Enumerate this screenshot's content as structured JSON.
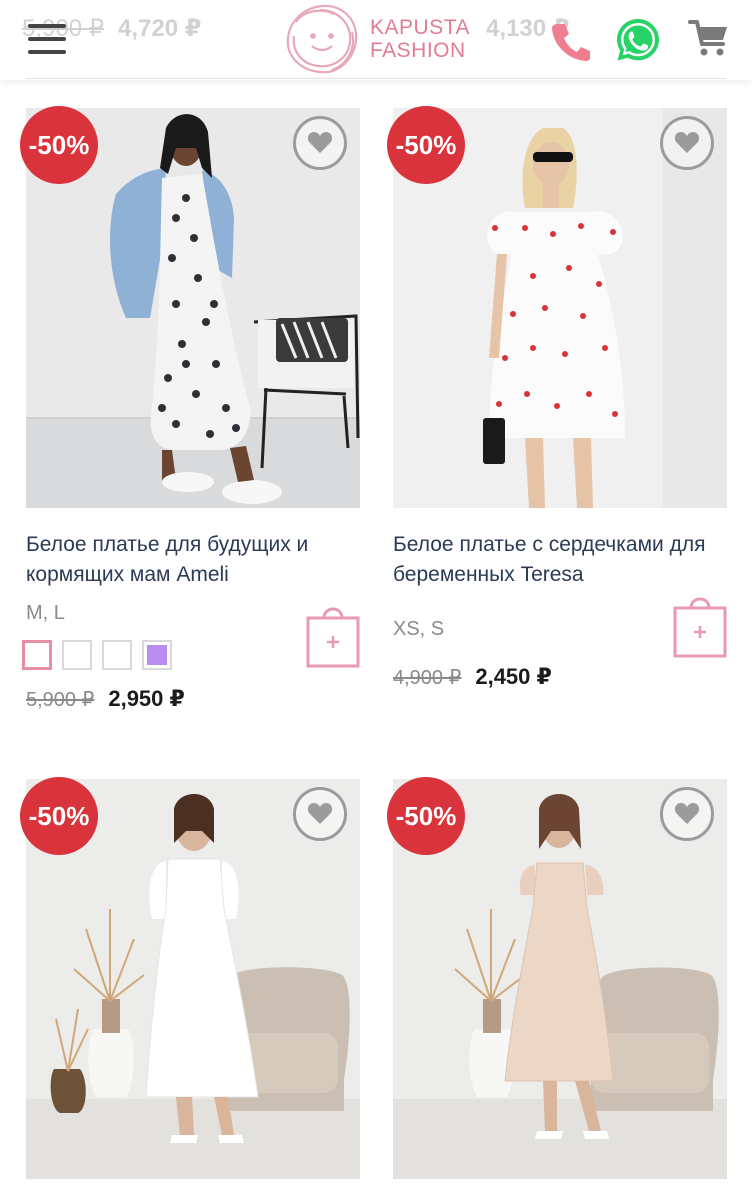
{
  "header": {
    "ghost_old_price": "5,900 ₽",
    "ghost_price_left": "4,720 ₽",
    "ghost_price_right": "4,130 ₽",
    "logo_line1": "KAPUSTA",
    "logo_line2": "FASHION",
    "icons": [
      "menu-icon",
      "phone-icon",
      "whatsapp-icon",
      "cart-icon"
    ]
  },
  "colors": {
    "brand_pink": "#e07c94",
    "badge_red": "#d9343c",
    "whatsapp_green": "#25d366",
    "title_text": "#2b3a55"
  },
  "products": [
    {
      "badge": "-50%",
      "title": "Белое платье для будущих и кормящих мам Ameli",
      "sizes": "M, L",
      "swatches": [
        "#ffffff",
        "#ffffff",
        "#ffffff",
        "#b98cf0"
      ],
      "old_price": "5,900 ₽",
      "price": "2,950 ₽"
    },
    {
      "badge": "-50%",
      "title": "Белое платье с сердечками для беременных Teresa",
      "sizes": "XS, S",
      "old_price": "4,900 ₽",
      "price": "2,450 ₽"
    },
    {
      "badge": "-50%"
    },
    {
      "badge": "-50%"
    }
  ]
}
